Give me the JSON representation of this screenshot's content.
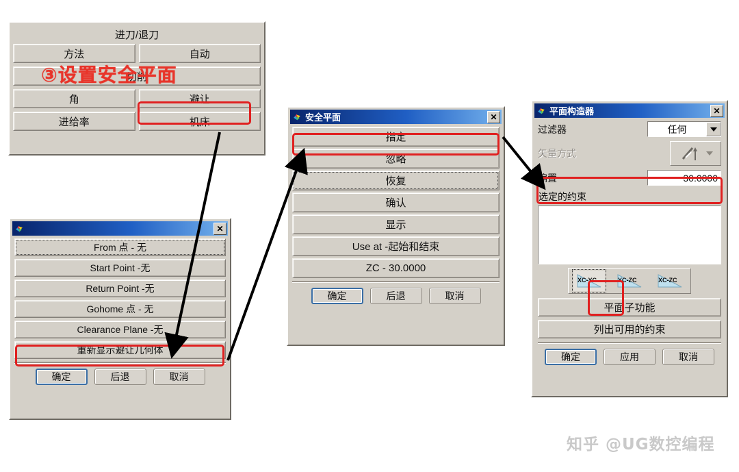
{
  "annotation": {
    "text": "③设置安全平面",
    "color": "#e8342a"
  },
  "watermark": {
    "text": "知乎 @UG数控编程"
  },
  "cut_panel": {
    "header": "进刀/退刀",
    "rows": [
      {
        "left": "方法",
        "right": "自动"
      },
      {
        "full": "切削"
      },
      {
        "left": "角",
        "right": "避让"
      },
      {
        "left": "进给率",
        "right": "机床"
      }
    ]
  },
  "avoid_dialog": {
    "title": "",
    "close_label": "✕",
    "buttons": [
      "From 点 - 无",
      "Start Point -无",
      "Return Point -无",
      "Gohome 点 - 无",
      "Clearance Plane -无",
      "重新显示避让几何体"
    ],
    "footer": [
      "确定",
      "后退",
      "取消"
    ]
  },
  "safeplane_dialog": {
    "title": "安全平面",
    "close_label": "✕",
    "buttons": [
      "指定",
      "忽略",
      "恢复",
      "确认",
      "显示",
      "Use at -起始和结束",
      "ZC - 30.0000"
    ],
    "footer": [
      "确定",
      "后退",
      "取消"
    ]
  },
  "plane_constructor": {
    "title": "平面构造器",
    "close_label": "✕",
    "filter_label": "过滤器",
    "filter_value": "任何",
    "vector_label": "矢量方式",
    "offset_label": "偏置",
    "offset_value": "30.0000",
    "constraints_label": "选定的约束",
    "plane_icons": [
      "XC-YC",
      "YC-ZC",
      "XC-ZC"
    ],
    "selected_plane_icon": "XC-YC",
    "subfunction_label": "平面子功能",
    "list_constraints_label": "列出可用的约束",
    "footer": [
      "确定",
      "应用",
      "取消"
    ]
  },
  "colors": {
    "highlight": "#e02020",
    "dialog_face": "#d4d0c8",
    "titlebar_start": "#08246b",
    "titlebar_end": "#74b1ec"
  }
}
